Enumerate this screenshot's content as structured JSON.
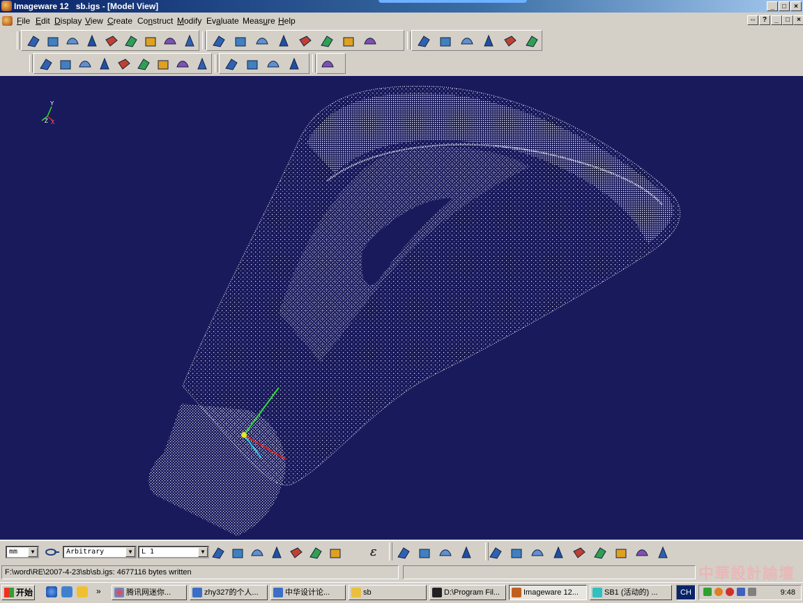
{
  "window": {
    "title": "Imageware 12   sb.igs - [Model View]",
    "min": "_",
    "max": "□",
    "close": "×"
  },
  "menubar": {
    "items": [
      {
        "label": "File",
        "accel": "F"
      },
      {
        "label": "Edit",
        "accel": "E"
      },
      {
        "label": "Display",
        "accel": "D"
      },
      {
        "label": "View",
        "accel": "V"
      },
      {
        "label": "Create",
        "accel": "C"
      },
      {
        "label": "Construct",
        "accel": "n"
      },
      {
        "label": "Modify",
        "accel": "M"
      },
      {
        "label": "Evaluate",
        "accel": "a"
      },
      {
        "label": "Measure",
        "accel": "u"
      },
      {
        "label": "Help",
        "accel": "H"
      }
    ],
    "mdi_buttons": [
      "⇔",
      "?",
      "_",
      "□",
      "×"
    ]
  },
  "toolbars": {
    "row1_icons": [
      "open-file-icon",
      "point-cloud-icon",
      "scan-icon",
      "surface-icon",
      "cube-icon",
      "text-icon",
      "cone-icon",
      "dome-icon",
      "patch-icon",
      "blend-surface-icon",
      "sweep-icon",
      "fillet-icon",
      "offset-surface-icon",
      "loft-icon",
      "curve-surface-icon",
      "plane-icon",
      "triangle-icon",
      "wireframe-box-icon",
      "wire-cube-icon",
      "network-icon",
      "cylinder-icon",
      "section-plane-icon",
      "axes-icon"
    ],
    "row2_icons": [
      "curve-green-icon",
      "cloud-section-icon",
      "surface-edit-icon",
      "split-icon",
      "trim-icon",
      "grid-icon",
      "bubble-icon",
      "knife-icon",
      "match-icon",
      "extend-icon",
      "flatten-icon",
      "rainbow-surface-icon",
      "palette-icon"
    ]
  },
  "viewport": {
    "background": "#191a5c",
    "triad": {
      "y": "Y",
      "z": "Z",
      "x": "X"
    }
  },
  "bottom_toolbar": {
    "units": "mm",
    "view_mode": "Arbitrary",
    "layer": "L 1",
    "epsilon": "ε"
  },
  "status": {
    "message": "F:\\word\\RE\\2007-4-23\\sb\\sb.igs: 4677116 bytes written"
  },
  "watermark": "中華設計論壇",
  "taskbar": {
    "start_label": "开始",
    "more": "»",
    "tasks": [
      {
        "label": "腾讯网迷你...",
        "color": "#2a7ad8"
      },
      {
        "label": "zhy327的个人...",
        "color": "#3c6ec8"
      },
      {
        "label": "中华设计论...",
        "color": "#3c6ec8"
      },
      {
        "label": "sb",
        "color": "#e8c040"
      },
      {
        "label": "D:\\Program Fil...",
        "color": "#202020"
      },
      {
        "label": "Imageware 12...",
        "color": "#c06020"
      },
      {
        "label": "SB1 (活动的) ...",
        "color": "#30c0c0"
      }
    ],
    "ch": "CH",
    "clock": "9:48"
  }
}
